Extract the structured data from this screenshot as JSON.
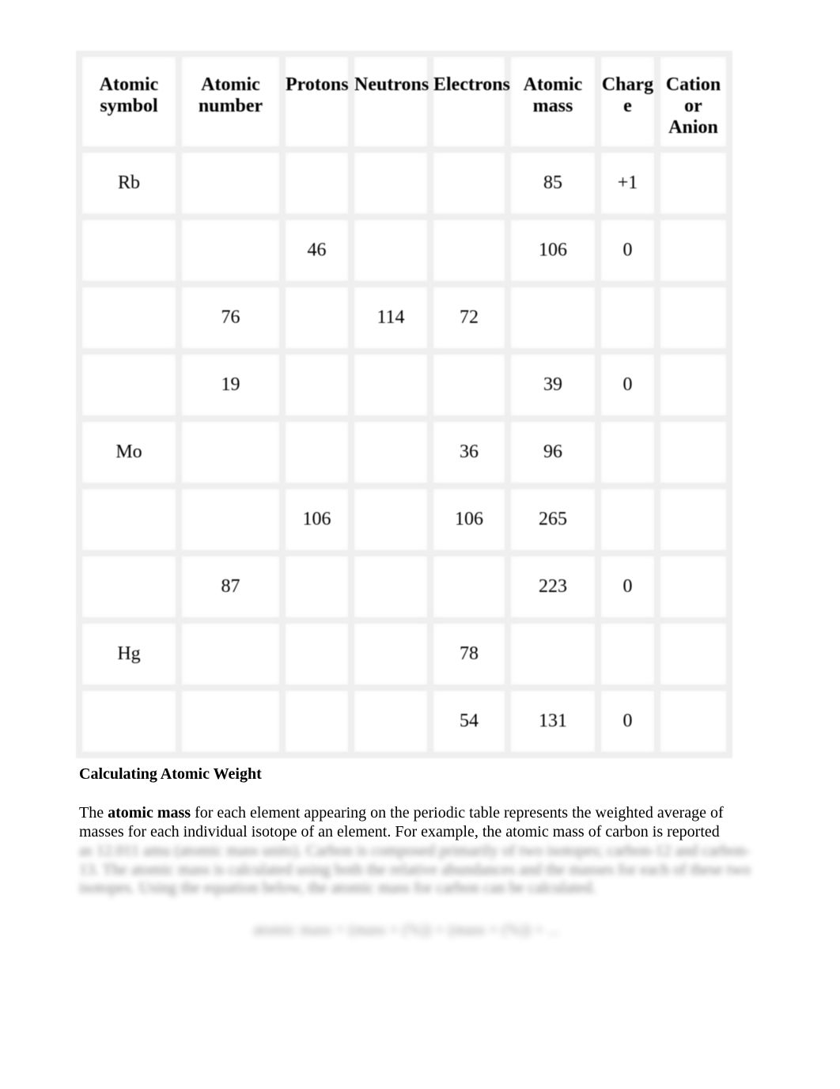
{
  "table": {
    "headers": [
      [
        "Atomic",
        "symbol"
      ],
      [
        "Atomic",
        "number"
      ],
      [
        "Protons"
      ],
      [
        "Neutrons"
      ],
      [
        "Electrons"
      ],
      [
        "Atomic",
        "mass"
      ],
      [
        "Charg",
        "e"
      ],
      [
        "Cation",
        "or",
        "Anion"
      ]
    ],
    "rows": [
      [
        "Rb",
        "",
        "",
        "",
        "",
        "85",
        "+1",
        ""
      ],
      [
        "",
        "",
        "46",
        "",
        "",
        "106",
        "0",
        ""
      ],
      [
        "",
        "76",
        "",
        "114",
        "72",
        "",
        "",
        ""
      ],
      [
        "",
        "19",
        "",
        "",
        "",
        "39",
        "0",
        ""
      ],
      [
        "Mo",
        "",
        "",
        "",
        "36",
        "96",
        "",
        ""
      ],
      [
        "",
        "",
        "106",
        "",
        "106",
        "265",
        "",
        ""
      ],
      [
        "",
        "87",
        "",
        "",
        "",
        "223",
        "0",
        ""
      ],
      [
        "Hg",
        "",
        "",
        "",
        "78",
        "",
        "",
        ""
      ],
      [
        "",
        "",
        "",
        "",
        "54",
        "131",
        "0",
        ""
      ]
    ]
  },
  "section": {
    "heading": "Calculating Atomic Weight",
    "para_intro": "The ",
    "para_bold": "atomic mass",
    "para_rest": " for each element appearing on the periodic table represents the weighted average of masses for each individual isotope of an element. For example, the atomic mass of carbon is reported",
    "blurred_text": "as 12.011 amu (atomic mass units). Carbon is composed primarily of two isotopes; carbon-12 and carbon-13. The atomic mass is calculated using both the relative abundances and the masses for each of these two isotopes. Using the equation below, the atomic mass for carbon can be calculated.",
    "blurred_formula": "atomic mass = (mass × (%)) + (mass × (%)) + ..."
  }
}
